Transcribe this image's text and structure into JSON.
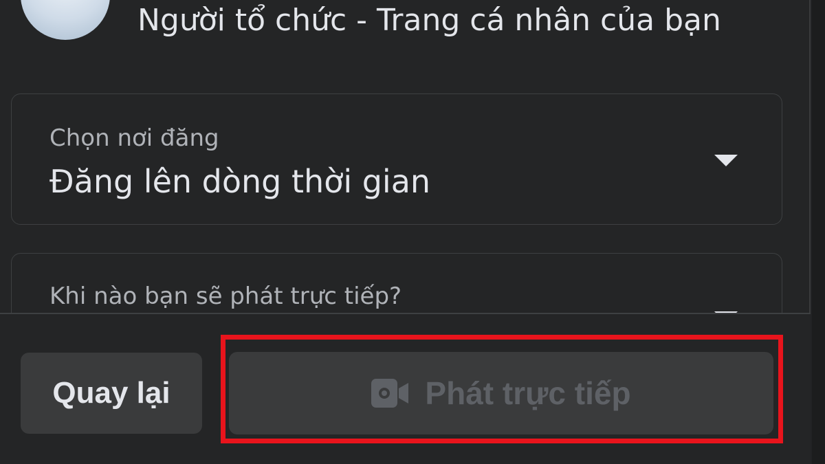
{
  "profile": {
    "subtitle": "Người tổ chức - Trang cá nhân của bạn"
  },
  "post_location": {
    "label": "Chọn nơi đăng",
    "value": "Đăng lên dòng thời gian"
  },
  "schedule": {
    "label": "Khi nào bạn sẽ phát trực tiếp?"
  },
  "footer": {
    "back_label": "Quay lại",
    "go_live_label": "Phát trực tiếp",
    "go_live_icon": "video-camera-icon"
  },
  "colors": {
    "background": "#242526",
    "button": "#3a3b3c",
    "disabled_text": "#5e6166",
    "highlight": "#e8141c"
  }
}
